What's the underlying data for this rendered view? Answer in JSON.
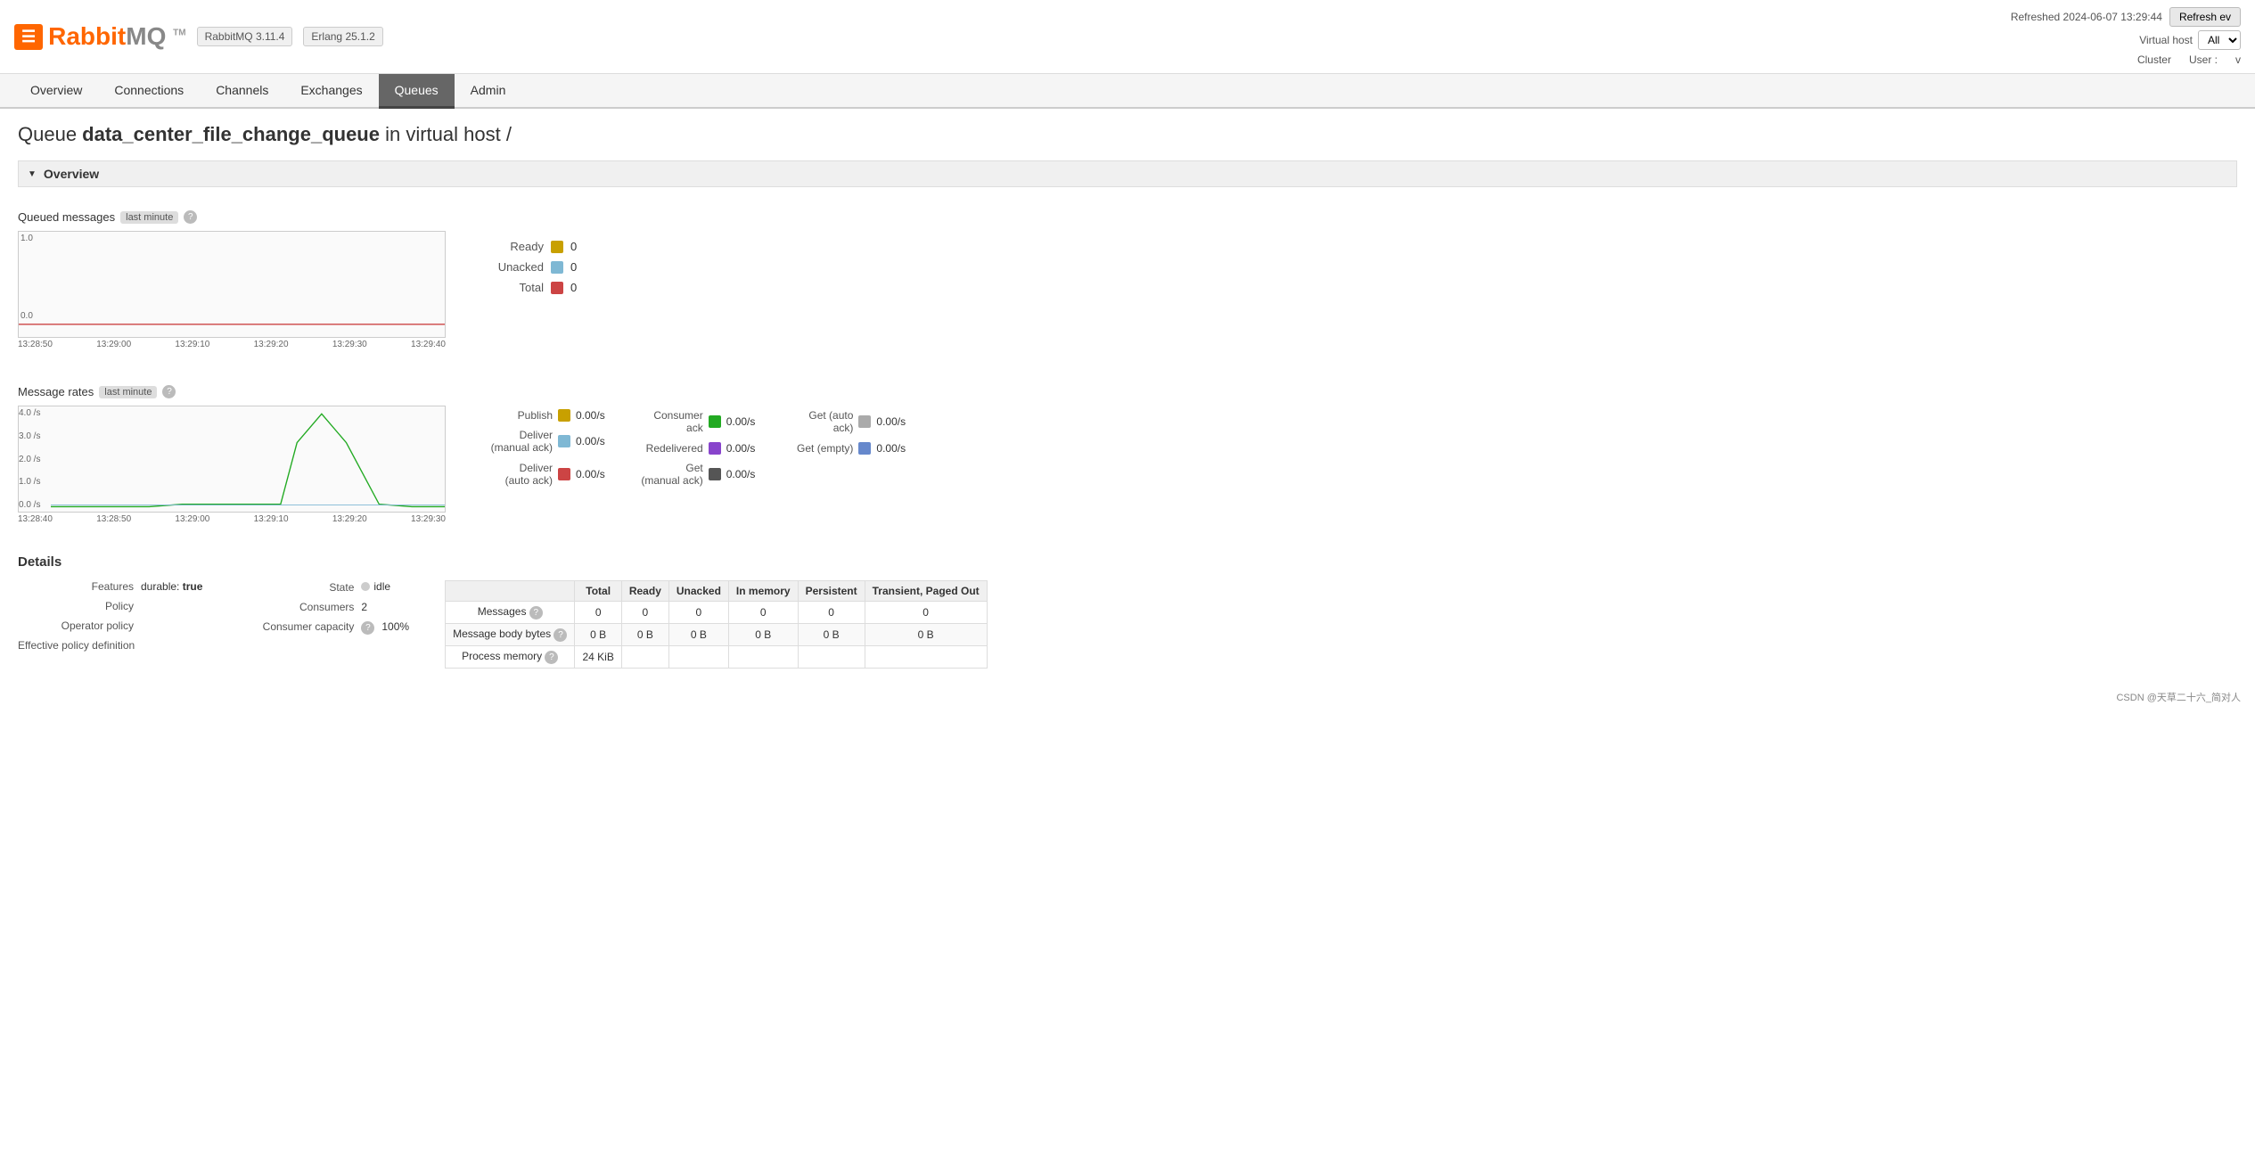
{
  "header": {
    "logo_text": "RabbitMQ",
    "logo_tm": "TM",
    "version": "RabbitMQ 3.11.4",
    "erlang": "Erlang 25.1.2",
    "refreshed": "Refreshed 2024-06-07 13:29:44",
    "refresh_btn": "Refresh ev",
    "vhost_label": "Virtual host",
    "vhost_value": "All",
    "cluster_label": "Cluster",
    "user_label": "User :",
    "user_value": "v"
  },
  "nav": {
    "items": [
      "Overview",
      "Connections",
      "Channels",
      "Exchanges",
      "Queues",
      "Admin"
    ],
    "active": "Queues"
  },
  "page": {
    "title_prefix": "Queue",
    "title_name": "data_center_file_change_queue",
    "title_suffix": "in virtual host /"
  },
  "overview_section": {
    "label": "Overview",
    "queued_messages_label": "Queued messages",
    "queued_messages_badge": "last minute",
    "queued_help": "?",
    "chart_queued": {
      "y_top": "1.0",
      "y_bottom": "0.0",
      "x_labels": [
        "13:28:50",
        "13:29:00",
        "13:29:10",
        "13:29:20",
        "13:29:30",
        "13:29:40"
      ]
    },
    "legend_queued": [
      {
        "label": "Ready",
        "color": "#c8a000",
        "value": "0"
      },
      {
        "label": "Unacked",
        "color": "#7fb8d4",
        "value": "0"
      },
      {
        "label": "Total",
        "color": "#c44",
        "value": "0"
      }
    ],
    "message_rates_label": "Message rates",
    "message_rates_badge": "last minute",
    "rates_help": "?",
    "chart_rates": {
      "y_labels": [
        "4.0 /s",
        "3.0 /s",
        "2.0 /s",
        "1.0 /s",
        "0.0 /s"
      ],
      "x_labels": [
        "13:28:40",
        "13:28:50",
        "13:29:00",
        "13:29:10",
        "13:29:20",
        "13:29:30"
      ]
    },
    "rates_col1": [
      {
        "label": "Publish",
        "color": "#c8a000",
        "value": "0.00/s"
      },
      {
        "label": "Deliver (manual ack)",
        "color": "#7fb8d4",
        "value": "0.00/s"
      },
      {
        "label": "Deliver (auto ack)",
        "color": "#c44",
        "value": "0.00/s"
      }
    ],
    "rates_col2": [
      {
        "label": "Consumer ack",
        "color": "#2a2",
        "value": "0.00/s"
      },
      {
        "label": "Redelivered",
        "color": "#8844cc",
        "value": "0.00/s"
      },
      {
        "label": "Get (manual ack)",
        "color": "#555",
        "value": "0.00/s"
      }
    ],
    "rates_col3": [
      {
        "label": "Get (auto ack)",
        "color": "#aaa",
        "value": "0.00/s"
      },
      {
        "label": "Get (empty)",
        "color": "#6688cc",
        "value": "0.00/s"
      }
    ]
  },
  "details": {
    "label": "Details",
    "features_label": "Features",
    "features_value": "durable:",
    "features_bool": "true",
    "policy_label": "Policy",
    "policy_value": "",
    "op_policy_label": "Operator policy",
    "op_policy_value": "",
    "eff_policy_label": "Effective policy definition",
    "eff_policy_value": "",
    "state_label": "State",
    "state_value": "idle",
    "consumers_label": "Consumers",
    "consumers_value": "2",
    "consumer_capacity_label": "Consumer capacity",
    "consumer_capacity_help": "?",
    "consumer_capacity_value": "100%",
    "table": {
      "headers": [
        "",
        "Total",
        "Ready",
        "Unacked",
        "In memory",
        "Persistent",
        "Transient, Paged Out"
      ],
      "rows": [
        {
          "label": "Messages",
          "help": "?",
          "values": [
            "0",
            "0",
            "0",
            "0",
            "0",
            "0"
          ]
        },
        {
          "label": "Message body bytes",
          "help": "?",
          "values": [
            "0 B",
            "0 B",
            "0 B",
            "0 B",
            "0 B",
            "0 B"
          ]
        },
        {
          "label": "Process memory",
          "help": "?",
          "values": [
            "24 KiB",
            "",
            "",
            "",
            "",
            ""
          ]
        }
      ]
    }
  },
  "footer": {
    "text": "CSDN @天草二十六_简对人"
  }
}
